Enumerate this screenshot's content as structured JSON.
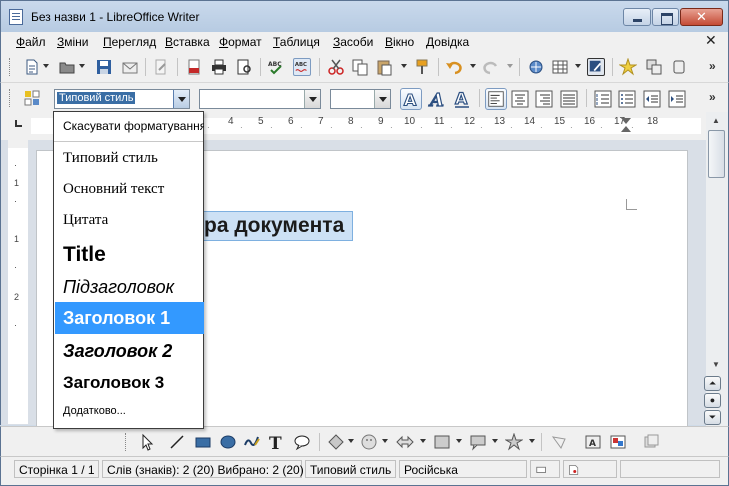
{
  "window": {
    "title": "Без назви 1 - LibreOffice Writer"
  },
  "menu": [
    {
      "u": "Ф",
      "rest": "айл"
    },
    {
      "u": "З",
      "rest": "міни"
    },
    {
      "u": "П",
      "rest": "ерегляд"
    },
    {
      "u": "В",
      "rest": "ставка"
    },
    {
      "u": "Ф",
      "rest": "ормат"
    },
    {
      "u": "Т",
      "rest": "аблиця"
    },
    {
      "u": "З",
      "rest": "асоби"
    },
    {
      "u": "В",
      "rest": "ікно"
    },
    {
      "u": "Д",
      "rest": "овідка"
    }
  ],
  "format_toolbar": {
    "style_value": "Типовий стиль",
    "font_value": "",
    "size_value": ""
  },
  "ruler": {
    "numbers": [
      "4",
      "5",
      "6",
      "7",
      "8",
      "9",
      "10",
      "11",
      "12",
      "13",
      "14",
      "15",
      "16",
      "17",
      "18"
    ],
    "vertical_numbers": [
      "1",
      "1",
      "2"
    ]
  },
  "document": {
    "visible_heading_text": "ра документа"
  },
  "style_list": {
    "items": [
      {
        "label": "Скасувати форматування",
        "selected": false
      },
      {
        "label": "Типовий стиль",
        "selected": false
      },
      {
        "label": "Основний текст",
        "selected": false
      },
      {
        "label": "Цитата",
        "selected": false
      },
      {
        "label": "Title",
        "selected": false
      },
      {
        "label": "Підзаголовок",
        "selected": false
      },
      {
        "label": "Заголовок 1",
        "selected": true
      },
      {
        "label": "Заголовок 2",
        "selected": false
      },
      {
        "label": "Заголовок 3",
        "selected": false
      },
      {
        "label": "Додатково...",
        "selected": false
      }
    ]
  },
  "status": {
    "page": "Сторінка 1 / 1",
    "words": "Слів (знаків): 2 (20) Вибрано: 2 (20)",
    "style": "Типовий стиль",
    "language": "Російська"
  },
  "colors": {
    "selection": "#3399ff",
    "window_frame": "#5b7392",
    "heading_highlight": "#cde1f5"
  }
}
